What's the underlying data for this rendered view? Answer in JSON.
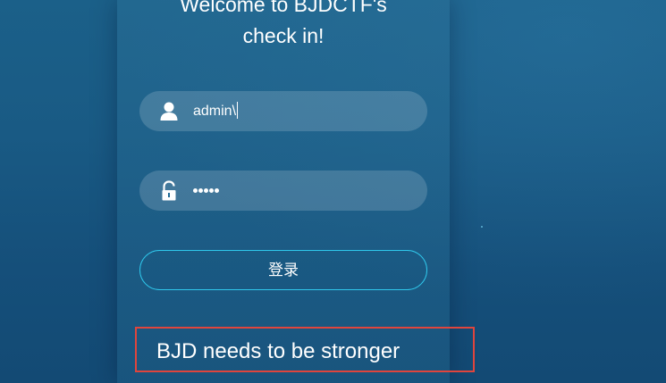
{
  "title": {
    "line1": "Welcome to BJDCTF's",
    "line2": "check in!"
  },
  "form": {
    "username": {
      "icon": "user-icon",
      "value": "admin\\"
    },
    "password": {
      "icon": "lock-icon",
      "masked_length": 5
    },
    "login_label": "登录"
  },
  "message": "BJD needs to be stronger",
  "colors": {
    "background": "#195a84",
    "button_border": "#2fc8ec",
    "highlight_box": "#e0453d",
    "text": "#ffffff"
  }
}
